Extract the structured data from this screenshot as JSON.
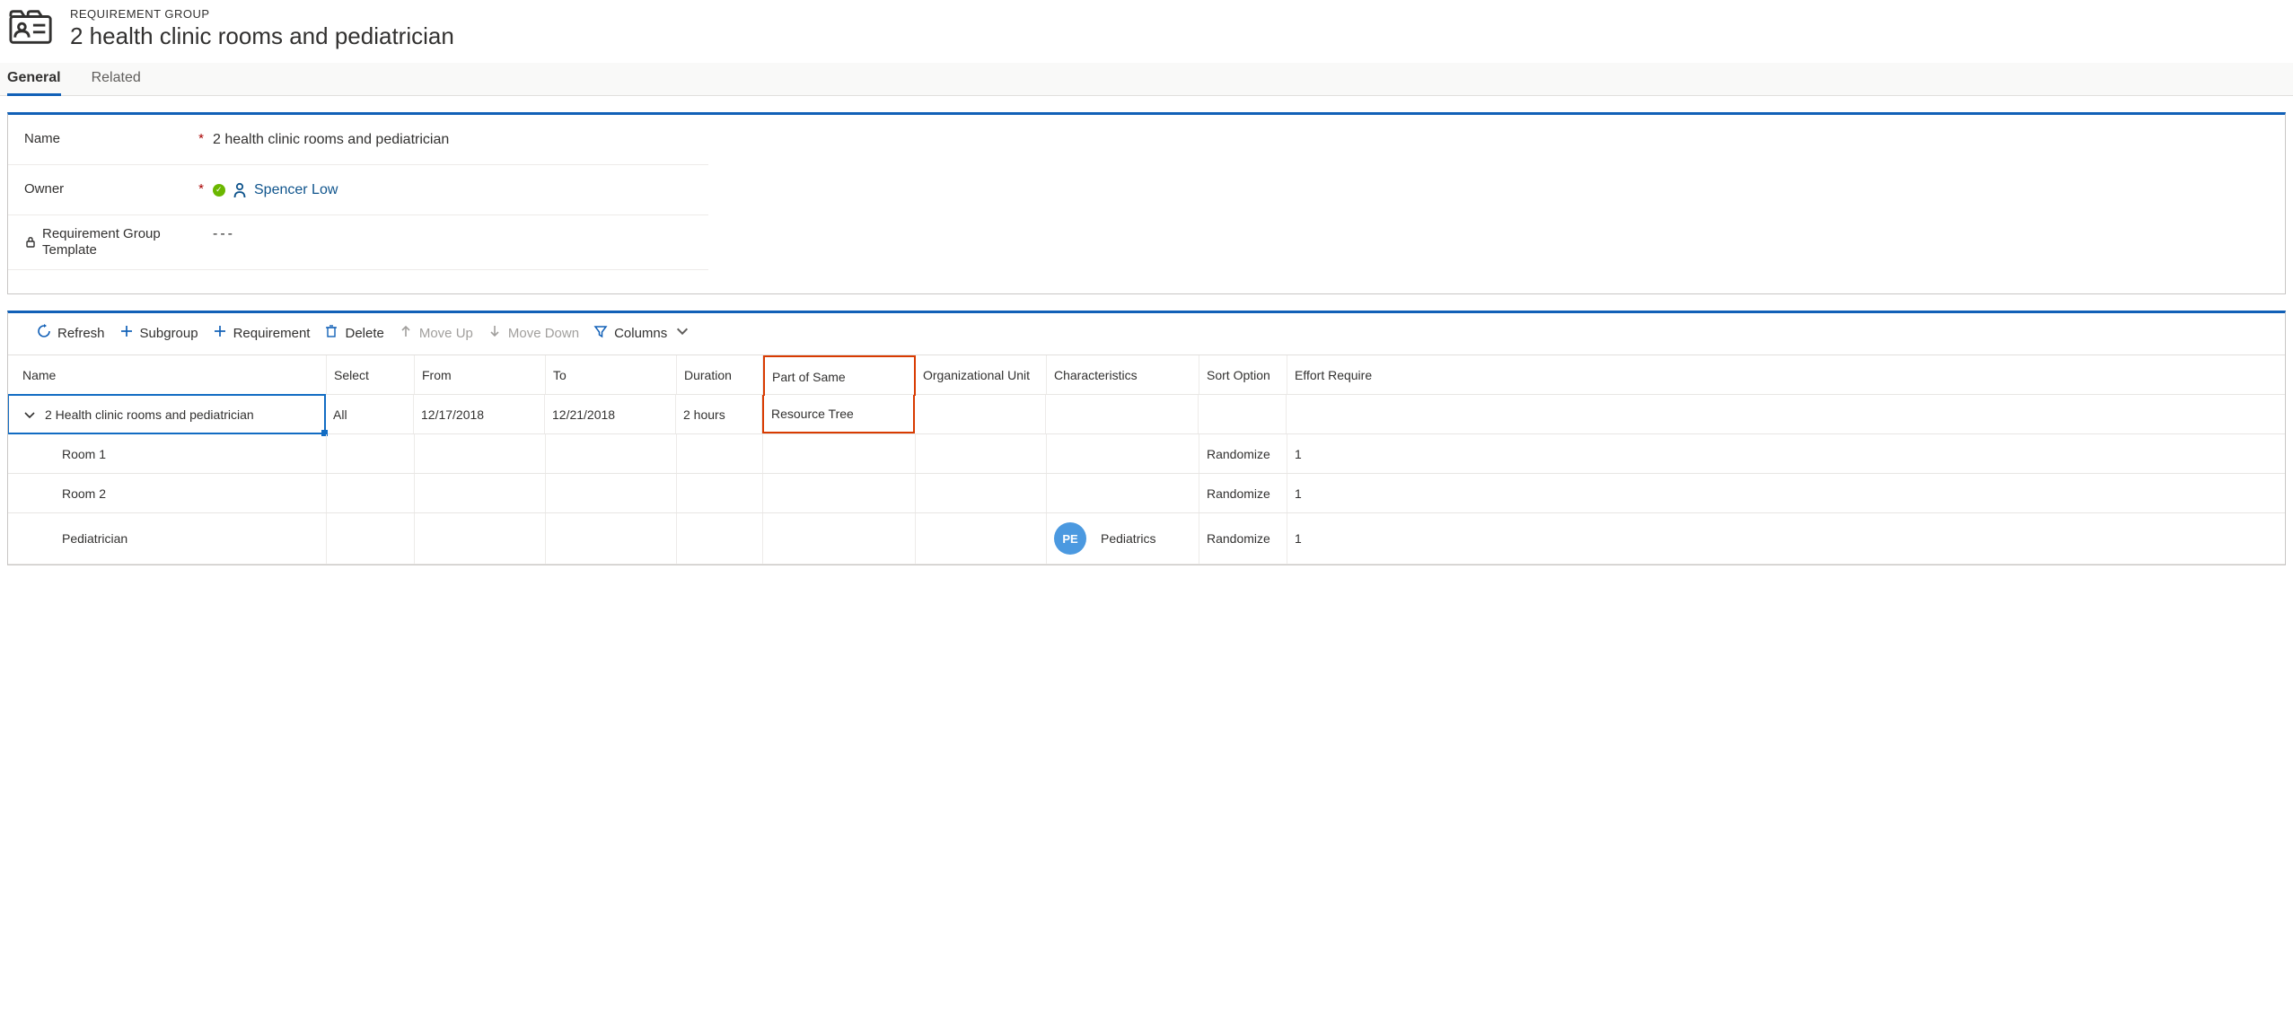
{
  "header": {
    "entity_type": "REQUIREMENT GROUP",
    "entity_name": "2 health clinic rooms and pediatrician"
  },
  "tabs": {
    "general": "General",
    "related": "Related"
  },
  "form": {
    "name_label": "Name",
    "name_value": "2 health clinic rooms and pediatrician",
    "owner_label": "Owner",
    "owner_value": "Spencer Low",
    "template_label": "Requirement Group Template",
    "template_value": "---"
  },
  "toolbar": {
    "refresh": "Refresh",
    "subgroup": "Subgroup",
    "requirement": "Requirement",
    "delete": "Delete",
    "moveup": "Move Up",
    "movedown": "Move Down",
    "columns": "Columns"
  },
  "grid": {
    "headers": {
      "name": "Name",
      "select": "Select",
      "from": "From",
      "to": "To",
      "duration": "Duration",
      "part": "Part of Same",
      "org": "Organizational Unit",
      "char": "Characteristics",
      "sort": "Sort Option",
      "effort": "Effort Require"
    },
    "main": {
      "name": "2 Health clinic rooms and pediatrician",
      "select": "All",
      "from": "12/17/2018",
      "to": "12/21/2018",
      "duration": "2 hours",
      "part": "Resource Tree"
    },
    "children": [
      {
        "name": "Room 1",
        "sort": "Randomize",
        "effort": "1"
      },
      {
        "name": "Room 2",
        "sort": "Randomize",
        "effort": "1"
      },
      {
        "name": "Pediatrician",
        "char_initials": "PE",
        "char_text": "Pediatrics",
        "sort": "Randomize",
        "effort": "1"
      }
    ]
  }
}
